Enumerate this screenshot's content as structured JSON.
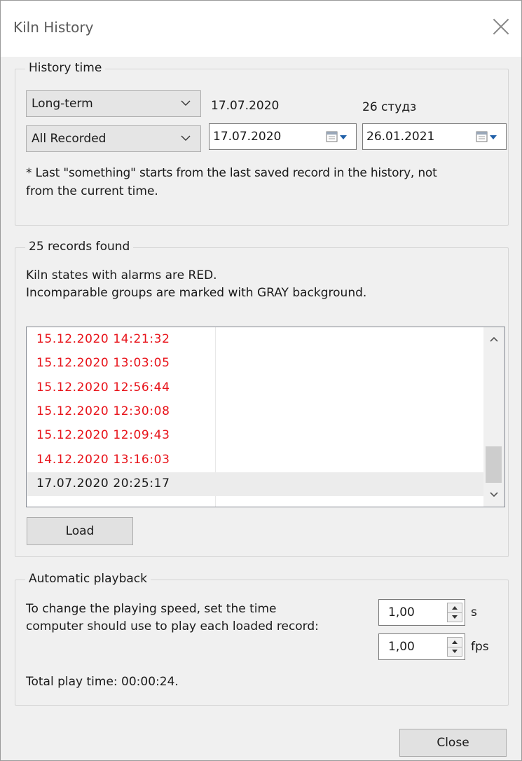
{
  "window": {
    "title": "Kiln History",
    "close_icon": "close-icon"
  },
  "history_time": {
    "legend": "History time",
    "period_combo": {
      "selected": "Long-term"
    },
    "range_combo": {
      "selected": "All Recorded"
    },
    "start_date_label": "17.07.2020",
    "end_date_label": "26 студз",
    "start_date_value": "17.07.2020",
    "end_date_value": "26.01.2021",
    "note_line1": "* Last \"something\" starts from the last saved record in the history, not",
    "note_line2": "from the current time."
  },
  "records": {
    "legend": "25 records found",
    "info_line1": "Kiln states with alarms are RED.",
    "info_line2": "Incomparable groups are marked with GRAY background.",
    "rows": [
      {
        "timestamp": "15.12.2020 14:21:32",
        "alarm": true,
        "gray": false
      },
      {
        "timestamp": "15.12.2020 13:03:05",
        "alarm": true,
        "gray": false
      },
      {
        "timestamp": "15.12.2020 12:56:44",
        "alarm": true,
        "gray": false
      },
      {
        "timestamp": "15.12.2020 12:30:08",
        "alarm": true,
        "gray": false
      },
      {
        "timestamp": "15.12.2020 12:09:43",
        "alarm": true,
        "gray": false
      },
      {
        "timestamp": "14.12.2020 13:16:03",
        "alarm": true,
        "gray": false
      },
      {
        "timestamp": "17.07.2020 20:25:17",
        "alarm": false,
        "gray": true
      }
    ],
    "load_label": "Load"
  },
  "playback": {
    "legend": "Automatic playback",
    "desc_line1": "To change the playing speed, set the time",
    "desc_line2": "computer should use to play each loaded record:",
    "seconds_value": "1,00",
    "seconds_unit": "s",
    "fps_value": "1,00",
    "fps_unit": "fps",
    "total_time": "Total play time: 00:00:24."
  },
  "footer": {
    "close_label": "Close"
  },
  "colors": {
    "alarm": "#e8131a",
    "gray_row": "#ececec",
    "background": "#f0f0f0"
  }
}
